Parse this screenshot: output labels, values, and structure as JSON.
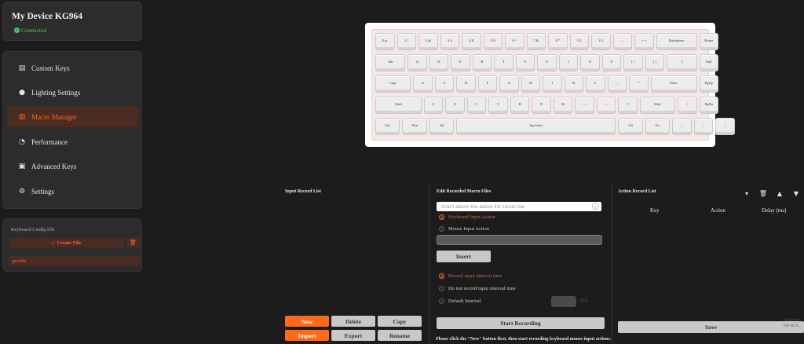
{
  "device": {
    "name": "My Device KG964",
    "status": "Connected"
  },
  "nav": {
    "items": [
      {
        "label": "Custom Keys",
        "icon": "keyboard-icon",
        "glyph": "▤"
      },
      {
        "label": "Lighting Settings",
        "icon": "bulb-icon",
        "glyph": "●"
      },
      {
        "label": "Macro Manager",
        "icon": "macro-icon",
        "glyph": "▥"
      },
      {
        "label": "Performance",
        "icon": "gauge-icon",
        "glyph": "◔"
      },
      {
        "label": "Advanced Keys",
        "icon": "chip-icon",
        "glyph": "▣"
      },
      {
        "label": "Settings",
        "icon": "gear-icon",
        "glyph": "⚙"
      }
    ],
    "active": "Macro Manager"
  },
  "config": {
    "title": "Keyboard Config File",
    "create_label": "Create File",
    "profile": "profile"
  },
  "keyboard": {
    "rows": [
      [
        "Esc",
        "1 !",
        "2 @",
        "3 #",
        "4 $",
        "5 %",
        "6 ^",
        "7 &",
        "8 *",
        "9 (",
        "0 )",
        "- _",
        "= +",
        "Backspace",
        "Home"
      ],
      [
        "Tab",
        "Q",
        "W",
        "E",
        "R",
        "T",
        "Y",
        "U",
        "I",
        "O",
        "P",
        "[ {",
        "] }",
        "\\ |",
        "End"
      ],
      [
        "Caps",
        "A",
        "S",
        "D",
        "F",
        "G",
        "H",
        "J",
        "K",
        "L",
        "; :",
        "' \"",
        "Enter",
        "PgUp"
      ],
      [
        "Shift",
        "Z",
        "X",
        "C",
        "V",
        "B",
        "N",
        "M",
        ", <",
        ". >",
        "/ ?",
        "Shift",
        "↑",
        "PgDn"
      ],
      [
        "Ctrl",
        "Win",
        "Alt",
        "Spacebar",
        "Alt",
        "Fn",
        "←",
        "↓",
        "→"
      ]
    ]
  },
  "input_record": {
    "title": "Input Record List",
    "buttons": {
      "new": "New",
      "delete": "Delete",
      "copy": "Copy",
      "import": "Import",
      "export": "Export",
      "rename": "Rename"
    }
  },
  "edit_macro": {
    "title": "Edit Recorded Macro Files",
    "insert_placeholder": "Insert above the action list cursor bar",
    "action_types": [
      "Keyboard Input Action",
      "Mouse Input Action"
    ],
    "insert_label": "Insert",
    "interval_options": [
      "Record input interval time",
      "Do not record input interval time",
      "Default Interval"
    ],
    "interval_unit": "(ms)",
    "start_label": "Start Recording",
    "hint": "Please click the \"New\" button first, then start recording keyboard mouse input actions."
  },
  "action_record": {
    "title": "Action Record List",
    "columns": [
      "Key",
      "Action",
      "Delay (ms)"
    ],
    "save_label": "Save"
  },
  "watermark": {
    "line1": "Activate",
    "line2": "Go to S..."
  },
  "colors": {
    "accent": "#ff6a1a",
    "connected": "#55c46a",
    "active_bg": "#4a2c22"
  }
}
